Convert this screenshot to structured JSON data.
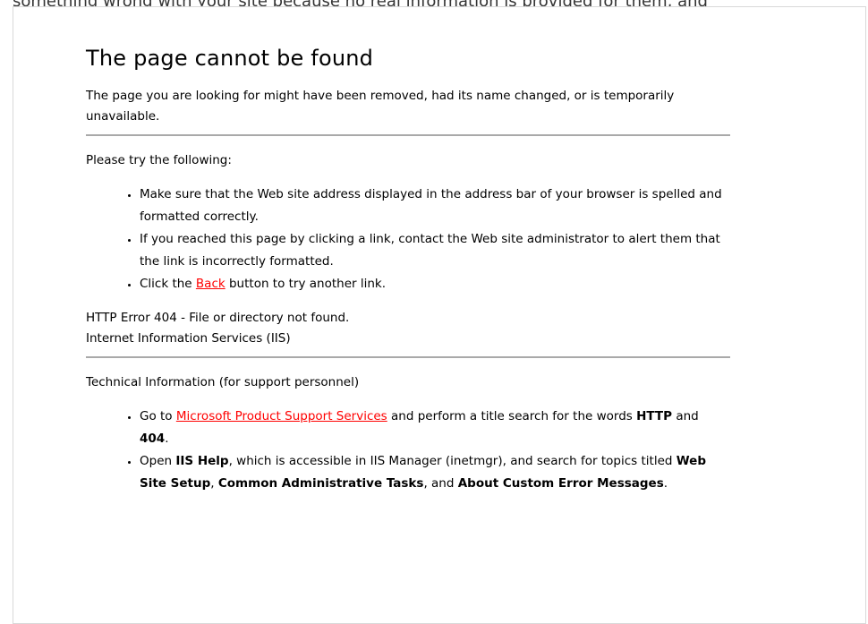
{
  "top_text": "something wrong with your site because no real information is provided for them, and",
  "title": "The page cannot be found",
  "intro": "The page you are looking for might have been removed, had its name changed, or is temporarily unavailable.",
  "try_heading": "Please try the following:",
  "try_items": {
    "item1": "Make sure that the Web site address displayed in the address bar of your browser is spelled and formatted correctly.",
    "item2": "If you reached this page by clicking a link, contact the Web site administrator to alert them that the link is incorrectly formatted.",
    "item3_prefix": "Click the ",
    "item3_link": "Back",
    "item3_suffix": " button to try another link."
  },
  "error_line1": "HTTP Error 404 - File or directory not found.",
  "error_line2": "Internet Information Services (IIS)",
  "tech_heading": "Technical Information (for support personnel)",
  "tech_items": {
    "item1_prefix": "Go to ",
    "item1_link": "Microsoft Product Support Services",
    "item1_mid": " and perform a title search for the words ",
    "item1_bold1": "HTTP",
    "item1_and": " and ",
    "item1_bold2": "404",
    "item1_end": ".",
    "item2_prefix": "Open ",
    "item2_bold1": "IIS Help",
    "item2_mid": ", which is accessible in IIS Manager (inetmgr), and search for topics titled ",
    "item2_bold2": "Web Site Setup",
    "item2_comma": ", ",
    "item2_bold3": "Common Administrative Tasks",
    "item2_and": ", and ",
    "item2_bold4": "About Custom Error Messages",
    "item2_end": "."
  },
  "colors": {
    "link": "#ff0000",
    "rule": "#a9a9a9",
    "frame_border": "#d9d9d9"
  }
}
